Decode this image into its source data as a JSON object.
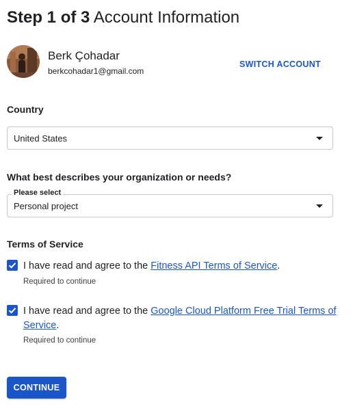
{
  "header": {
    "step": "Step 1 of 3",
    "title": "Account Information"
  },
  "account": {
    "name": "Berk Çohadar",
    "email": "berkcohadar1@gmail.com",
    "switch_label": "SWITCH ACCOUNT",
    "avatar_icon": "user-photo"
  },
  "country": {
    "label": "Country",
    "value": "United States"
  },
  "organization": {
    "label": "What best describes your organization or needs?",
    "float_label": "Please select",
    "value": "Personal project"
  },
  "terms": {
    "heading": "Terms of Service",
    "items": [
      {
        "checked": true,
        "prefix": "I have read and agree to the ",
        "link": "Fitness API Terms of Service",
        "suffix": ".",
        "hint": "Required to continue"
      },
      {
        "checked": true,
        "prefix": "I have read and agree to the ",
        "link": "Google Cloud Platform Free Trial Terms of Service",
        "suffix": ".",
        "hint": "Required to continue"
      }
    ]
  },
  "actions": {
    "continue_label": "CONTINUE"
  },
  "colors": {
    "accent": "#1a56c9",
    "text": "#202124",
    "border": "#c5c8cc"
  }
}
